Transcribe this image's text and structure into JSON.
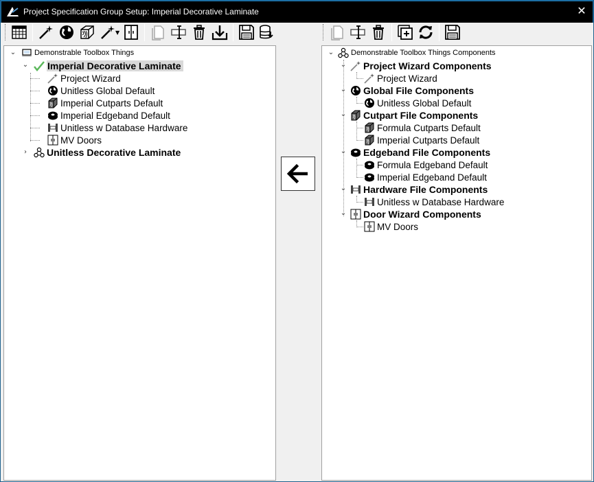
{
  "window": {
    "title": "Project Specification Group Setup: Imperial Decorative Laminate",
    "close_glyph": "✕"
  },
  "left_toolbar": {
    "buttons": [
      "spreadsheet-icon",
      "magic-wand-icon",
      "globe-icon",
      "wood-block-icon",
      "magic-wand-dropdown-icon",
      "door-icon",
      "copy-icon",
      "rename-icon",
      "delete-icon",
      "import-icon",
      "save-icon",
      "save-database-icon"
    ]
  },
  "right_toolbar": {
    "buttons": [
      "copy-icon",
      "rename-icon",
      "delete-icon",
      "add-icon",
      "refresh-icon",
      "save-icon"
    ]
  },
  "left_tree": {
    "root": {
      "label": "Demonstrable Toolbox Things",
      "icon": "computer-icon"
    },
    "groups": [
      {
        "label": "Imperial Decorative Laminate",
        "icon": "check-icon",
        "expanded": true,
        "selected": true,
        "children": [
          {
            "label": "Project Wizard",
            "icon": "wand-icon"
          },
          {
            "label": "Unitless Global Default",
            "icon": "globe-icon"
          },
          {
            "label": "Imperial Cutparts Default",
            "icon": "cube-icon"
          },
          {
            "label": "Imperial Edgeband Default",
            "icon": "edgeband-icon"
          },
          {
            "label": "Unitless w Database Hardware",
            "icon": "hardware-icon"
          },
          {
            "label": "MV Doors",
            "icon": "door-icon"
          }
        ]
      },
      {
        "label": "Unitless Decorative Laminate",
        "icon": "components-icon",
        "expanded": false,
        "children": []
      }
    ]
  },
  "right_tree": {
    "root": {
      "label": "Demonstrable Toolbox Things Components",
      "icon": "components-icon"
    },
    "groups": [
      {
        "label": "Project Wizard Components",
        "icon": "wand-icon",
        "children": [
          {
            "label": "Project Wizard",
            "icon": "wand-icon"
          }
        ]
      },
      {
        "label": "Global File Components",
        "icon": "globe-icon",
        "children": [
          {
            "label": "Unitless Global Default",
            "icon": "globe-icon"
          }
        ]
      },
      {
        "label": "Cutpart File Components",
        "icon": "cube-icon",
        "children": [
          {
            "label": "Formula Cutparts Default",
            "icon": "cube-icon"
          },
          {
            "label": "Imperial Cutparts Default",
            "icon": "cube-icon"
          }
        ]
      },
      {
        "label": "Edgeband File Components",
        "icon": "edgeband-icon",
        "children": [
          {
            "label": "Formula Edgeband Default",
            "icon": "edgeband-icon"
          },
          {
            "label": "Imperial Edgeband Default",
            "icon": "edgeband-icon"
          }
        ]
      },
      {
        "label": "Hardware File Components",
        "icon": "hardware-icon",
        "children": [
          {
            "label": "Unitless w Database Hardware",
            "icon": "hardware-icon"
          }
        ]
      },
      {
        "label": "Door Wizard Components",
        "icon": "door-icon",
        "children": [
          {
            "label": "MV Doors",
            "icon": "door-icon"
          }
        ]
      }
    ]
  },
  "transfer_button": {
    "icon": "arrow-left-icon"
  },
  "colors": {
    "title_bar": "#000000",
    "border": "#1c6ea4",
    "selection": "#d9d9d9",
    "check": "#5cb85c"
  }
}
